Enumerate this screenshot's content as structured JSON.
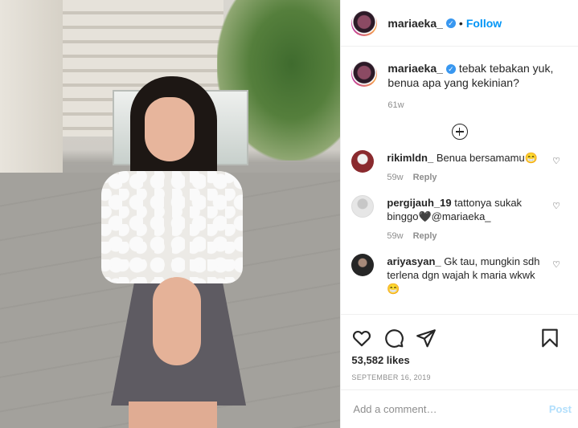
{
  "header": {
    "username": "mariaeka_",
    "verified_mark": "✓",
    "separator": "•",
    "follow_label": "Follow"
  },
  "caption": {
    "username": "mariaeka_",
    "verified_mark": "✓",
    "text": "tebak tebakan yuk, benua apa yang kekinian?",
    "time": "61w"
  },
  "comments": [
    {
      "username": "rikimldn_",
      "text": "Benua bersamamu😁",
      "time": "59w",
      "reply_label": "Reply"
    },
    {
      "username": "pergijauh_19",
      "text": "tattonya sukak binggo🖤@mariaeka_",
      "time": "59w",
      "reply_label": "Reply"
    },
    {
      "username": "ariyasyan_",
      "text": "Gk tau, mungkin sdh terlena dgn wajah k maria wkwk 😁",
      "time": "",
      "reply_label": ""
    }
  ],
  "stats": {
    "likes": "53,582 likes",
    "date": "SEPTEMBER 16, 2019"
  },
  "add_comment": {
    "placeholder": "Add a comment…",
    "post_label": "Post"
  },
  "icons": [
    "heart-icon",
    "comment-icon",
    "share-icon",
    "bookmark-icon",
    "add-comments-icon"
  ]
}
